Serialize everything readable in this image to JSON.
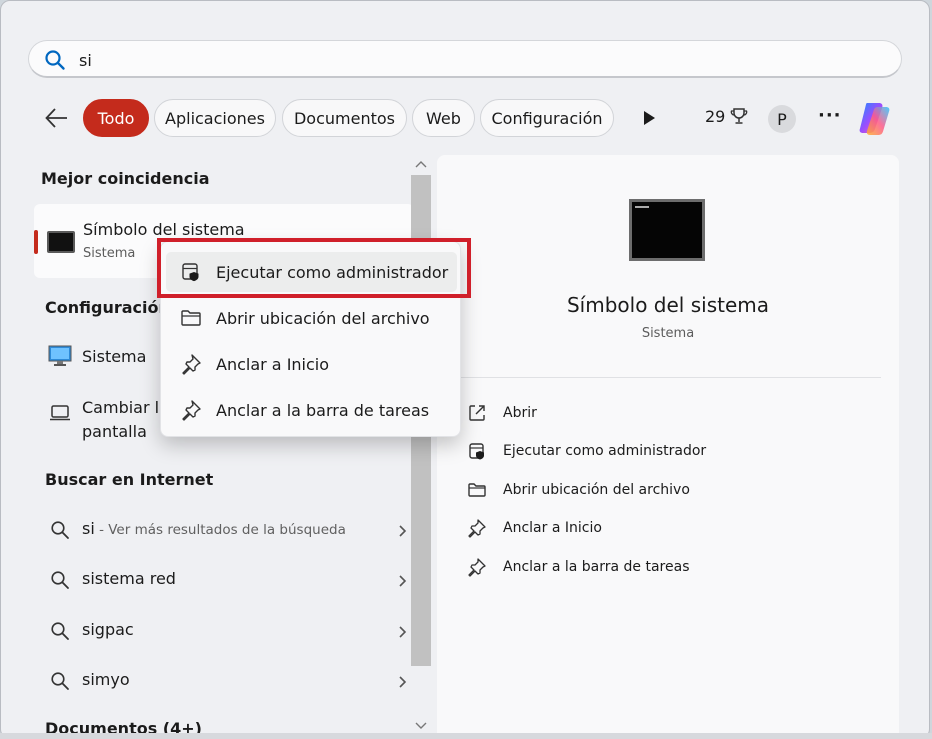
{
  "search": {
    "value": "si"
  },
  "filters": {
    "items": [
      "Todo",
      "Aplicaciones",
      "Documentos",
      "Web",
      "Configuración"
    ],
    "points": "29",
    "avatar": "P"
  },
  "left": {
    "best_match_heading": "Mejor coincidencia",
    "best_match": {
      "title": "Símbolo del sistema",
      "subtitle": "Sistema"
    },
    "settings_heading": "Configuración",
    "settings_items": [
      {
        "label": "Sistema"
      },
      {
        "label_line1": "Cambiar la",
        "label_line2": "pantalla"
      }
    ],
    "web_heading": "Buscar en Internet",
    "web_items": [
      {
        "label": "si",
        "suffix": " - Ver más resultados de la búsqueda"
      },
      {
        "label": "sistema red"
      },
      {
        "label": "sigpac"
      },
      {
        "label": "simyo"
      }
    ],
    "documents_heading": "Documentos (4+)"
  },
  "right": {
    "title": "Símbolo del sistema",
    "subtitle": "Sistema",
    "actions": [
      "Abrir",
      "Ejecutar como administrador",
      "Abrir ubicación del archivo",
      "Anclar a Inicio",
      "Anclar a la barra de tareas"
    ]
  },
  "context_menu": {
    "items": [
      "Ejecutar como administrador",
      "Abrir ubicación del archivo",
      "Anclar a Inicio",
      "Anclar a la barra de tareas"
    ]
  },
  "colors": {
    "accent": "#c42b1c",
    "highlight_box": "#d01f2a"
  }
}
